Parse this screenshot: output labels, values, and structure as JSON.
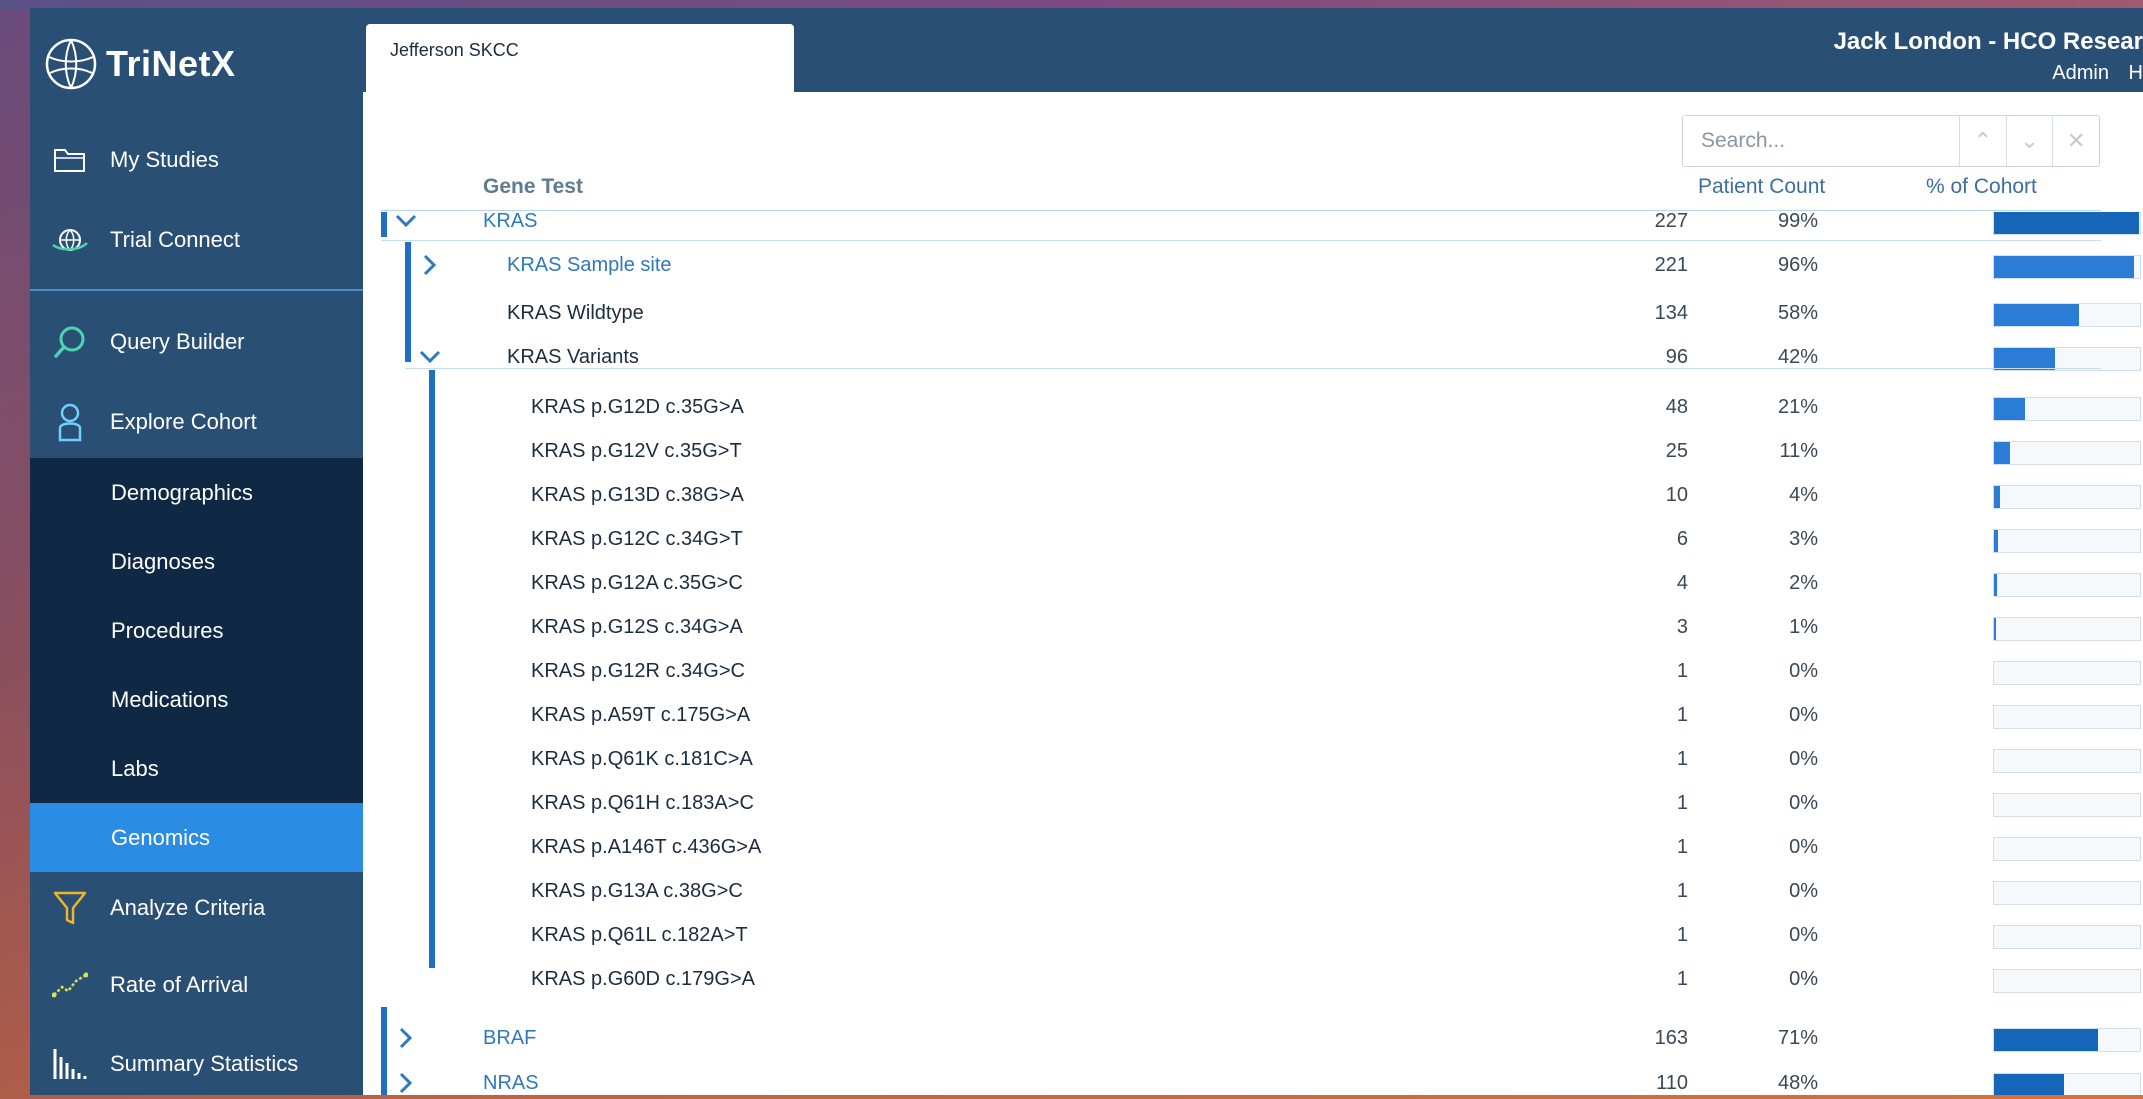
{
  "app": {
    "logo_text": "TriNetX"
  },
  "sidebar": {
    "main_items": [
      {
        "label": "My Studies",
        "icon": "folder-icon"
      },
      {
        "label": "Trial Connect",
        "icon": "globe-icon"
      },
      {
        "label": "Query Builder",
        "icon": "search-icon"
      },
      {
        "label": "Explore Cohort",
        "icon": "person-icon"
      }
    ],
    "sub_items": [
      {
        "label": "Demographics"
      },
      {
        "label": "Diagnoses"
      },
      {
        "label": "Procedures"
      },
      {
        "label": "Medications"
      },
      {
        "label": "Labs"
      },
      {
        "label": "Genomics",
        "active": true
      }
    ],
    "bottom_items": [
      {
        "label": "Analyze Criteria",
        "icon": "funnel-icon"
      },
      {
        "label": "Rate of Arrival",
        "icon": "trend-icon"
      },
      {
        "label": "Summary Statistics",
        "icon": "bar-chart-icon"
      }
    ]
  },
  "header": {
    "tab_label": "Jefferson SKCC",
    "user_name": "Jack London - HCO Resear",
    "links": [
      "Admin",
      "H"
    ]
  },
  "search": {
    "placeholder": "Search..."
  },
  "table": {
    "columns": {
      "gene_test": "Gene Test",
      "patient_count": "Patient Count",
      "pct_cohort": "% of Cohort"
    },
    "rows": [
      {
        "name": "KRAS",
        "count": "227",
        "pct": "99%",
        "fraction": 0.99,
        "level": 0,
        "expanded": true,
        "link": true
      },
      {
        "name": "KRAS Sample site",
        "count": "221",
        "pct": "96%",
        "fraction": 0.96,
        "level": 1,
        "expandable": true,
        "link": true
      },
      {
        "name": "KRAS Wildtype",
        "count": "134",
        "pct": "58%",
        "fraction": 0.58,
        "level": 1
      },
      {
        "name": "KRAS Variants",
        "count": "96",
        "pct": "42%",
        "fraction": 0.42,
        "level": 1,
        "expanded": true
      },
      {
        "name": "KRAS p.G12D c.35G>A",
        "count": "48",
        "pct": "21%",
        "fraction": 0.21,
        "level": 2
      },
      {
        "name": "KRAS p.G12V c.35G>T",
        "count": "25",
        "pct": "11%",
        "fraction": 0.11,
        "level": 2
      },
      {
        "name": "KRAS p.G13D c.38G>A",
        "count": "10",
        "pct": "4%",
        "fraction": 0.04,
        "level": 2
      },
      {
        "name": "KRAS p.G12C c.34G>T",
        "count": "6",
        "pct": "3%",
        "fraction": 0.03,
        "level": 2
      },
      {
        "name": "KRAS p.G12A c.35G>C",
        "count": "4",
        "pct": "2%",
        "fraction": 0.02,
        "level": 2
      },
      {
        "name": "KRAS p.G12S c.34G>A",
        "count": "3",
        "pct": "1%",
        "fraction": 0.01,
        "level": 2
      },
      {
        "name": "KRAS p.G12R c.34G>C",
        "count": "1",
        "pct": "0%",
        "fraction": 0.0,
        "level": 2
      },
      {
        "name": "KRAS p.A59T c.175G>A",
        "count": "1",
        "pct": "0%",
        "fraction": 0.0,
        "level": 2
      },
      {
        "name": "KRAS p.Q61K c.181C>A",
        "count": "1",
        "pct": "0%",
        "fraction": 0.0,
        "level": 2
      },
      {
        "name": "KRAS p.Q61H c.183A>C",
        "count": "1",
        "pct": "0%",
        "fraction": 0.0,
        "level": 2
      },
      {
        "name": "KRAS p.A146T c.436G>A",
        "count": "1",
        "pct": "0%",
        "fraction": 0.0,
        "level": 2
      },
      {
        "name": "KRAS p.G13A c.38G>C",
        "count": "1",
        "pct": "0%",
        "fraction": 0.0,
        "level": 2
      },
      {
        "name": "KRAS p.Q61L c.182A>T",
        "count": "1",
        "pct": "0%",
        "fraction": 0.0,
        "level": 2
      },
      {
        "name": "KRAS p.G60D c.179G>A",
        "count": "1",
        "pct": "0%",
        "fraction": 0.0,
        "level": 2
      },
      {
        "name": "BRAF",
        "count": "163",
        "pct": "71%",
        "fraction": 0.71,
        "level": 0,
        "expandable": true,
        "link": true
      },
      {
        "name": "NRAS",
        "count": "110",
        "pct": "48%",
        "fraction": 0.48,
        "level": 0,
        "expandable": true,
        "link": true
      }
    ]
  },
  "colors": {
    "sidebar_bg": "#2a4f75",
    "subnav_bg": "#0f2844",
    "active_bg": "#2b8ce3",
    "accent_line": "#1f6fc4",
    "bar_fill": "#2b7cd6"
  }
}
